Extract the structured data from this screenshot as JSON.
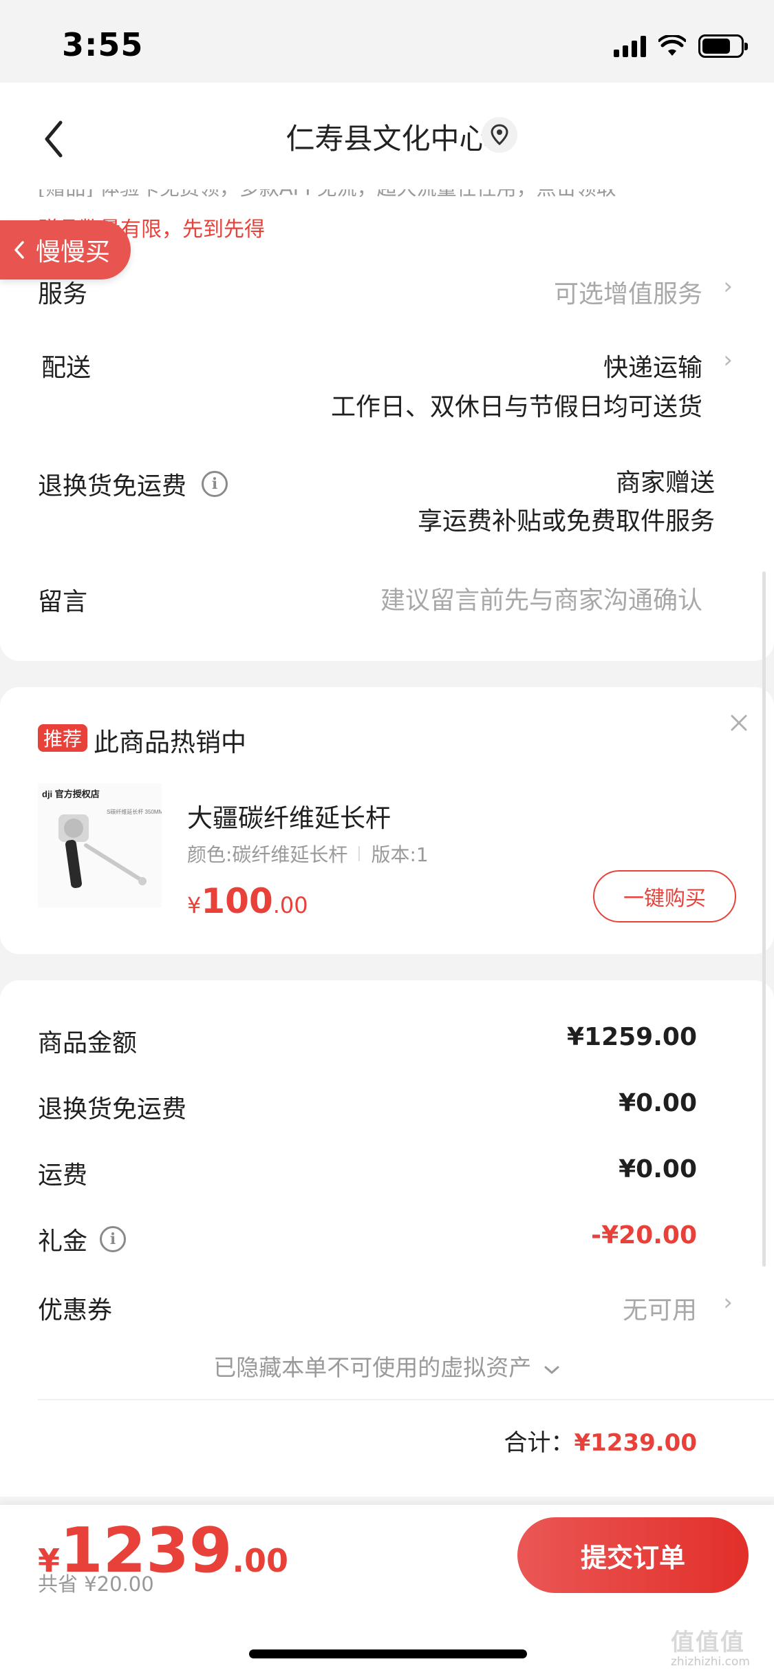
{
  "status_bar": {
    "time": "3:55"
  },
  "header": {
    "title": "仁寿县文化中心"
  },
  "order_info": {
    "promo_text": "[赠品] 体验卡免费领，多款APP免流，超大流量任性用，点击领取",
    "gift_note": "赠品数量有限，先到先得",
    "slow_buy_label": "慢慢买",
    "service_label": "服务",
    "service_value": "可选增值服务",
    "delivery_label": "配送",
    "delivery_method": "快递运输",
    "delivery_note": "工作日、双休日与节假日均可送货",
    "return_label": "退换货免运费",
    "return_value": "商家赠送",
    "return_note": "享运费补贴或免费取件服务",
    "message_label": "留言",
    "message_placeholder": "建议留言前先与商家沟通确认"
  },
  "recommend": {
    "badge": "推荐",
    "title": "此商品热销中",
    "product_name": "大疆碳纤维延长杆",
    "spec_color": "颜色:碳纤维延长杆",
    "spec_version": "版本:1",
    "price_symbol": "¥",
    "price_int": "100",
    "price_dec": ".00",
    "buy_label": "一键购买",
    "image_brand": "dji 官方授权店",
    "image_caption": "S碳纤维延长杆 350MM"
  },
  "summary": {
    "goods_label": "商品金额",
    "goods_value": "¥1259.00",
    "return_fee_label": "退换货免运费",
    "return_fee_value": "¥0.00",
    "shipping_label": "运费",
    "shipping_value": "¥0.00",
    "gift_money_label": "礼金",
    "gift_money_value": "-¥20.00",
    "coupon_label": "优惠券",
    "coupon_value": "无可用",
    "hidden_note": "已隐藏本单不可使用的虚拟资产",
    "total_label": "合计：",
    "total_value": "¥1239.00"
  },
  "bottom_bar": {
    "price_symbol": "¥",
    "price_int": "1239",
    "price_dec": ".00",
    "saved": "共省 ¥20.00",
    "submit_label": "提交订单"
  },
  "watermark": {
    "main": "值值值",
    "sub": "zhizhizhi.com"
  },
  "colors": {
    "accent": "#e8413a",
    "muted": "#a8a8a8",
    "background": "#f3f3f3"
  }
}
